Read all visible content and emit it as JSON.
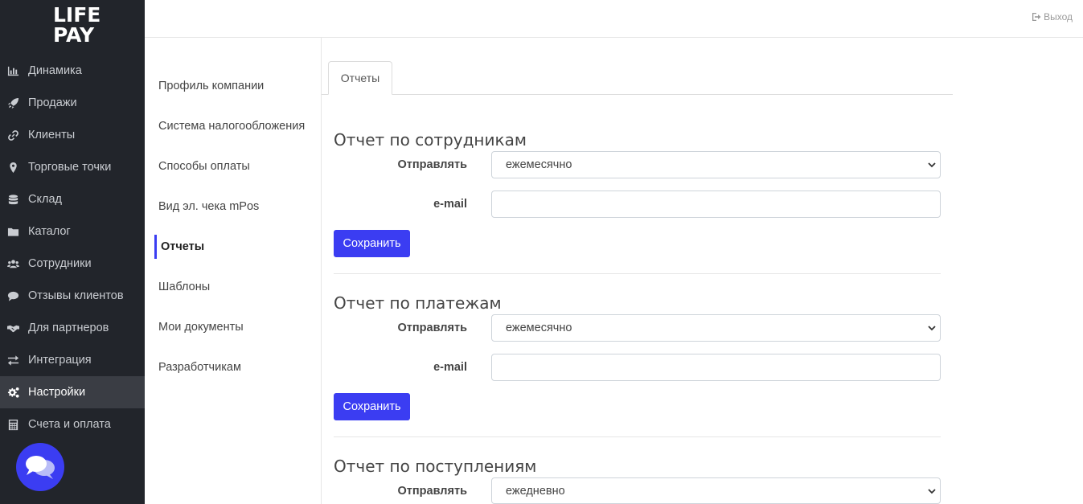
{
  "logo": {
    "line1": "LIFE",
    "line2": "PAY"
  },
  "sidebar": {
    "items": [
      {
        "label": "Динамика",
        "icon": "bar-chart-icon",
        "active": false
      },
      {
        "label": "Продажи",
        "icon": "rocket-icon",
        "active": false
      },
      {
        "label": "Клиенты",
        "icon": "link-icon",
        "active": false
      },
      {
        "label": "Торговые точки",
        "icon": "map-marker-icon",
        "active": false
      },
      {
        "label": "Склад",
        "icon": "database-icon",
        "active": false
      },
      {
        "label": "Каталог",
        "icon": "folder-icon",
        "active": false
      },
      {
        "label": "Сотрудники",
        "icon": "users-icon",
        "active": false
      },
      {
        "label": "Отзывы клиентов",
        "icon": "comment-icon",
        "active": false
      },
      {
        "label": "Для партнеров",
        "icon": "handshake-icon",
        "active": false
      },
      {
        "label": "Интеграция",
        "icon": "exchange-icon",
        "active": false
      },
      {
        "label": "Настройки",
        "icon": "gears-icon",
        "active": true
      },
      {
        "label": "Счета и оплата",
        "icon": "calculator-icon",
        "active": false
      }
    ]
  },
  "topbar": {
    "logout_label": "Выход"
  },
  "submenu": {
    "items": [
      {
        "label": "Профиль компании"
      },
      {
        "label": "Система налогообложения"
      },
      {
        "label": "Способы оплаты"
      },
      {
        "label": "Вид эл. чека mPos"
      },
      {
        "label": "Отчеты",
        "active": true
      },
      {
        "label": "Шаблоны"
      },
      {
        "label": "Мои документы"
      },
      {
        "label": "Разработчикам"
      }
    ]
  },
  "tabs": [
    {
      "label": "Отчеты",
      "active": true
    }
  ],
  "sections": [
    {
      "title": "Отчет по сотрудникам",
      "send_label": "Отправлять",
      "send_value": "ежемесячно",
      "email_label": "e-mail",
      "email_value": "",
      "save_label": "Сохранить"
    },
    {
      "title": "Отчет по платежам",
      "send_label": "Отправлять",
      "send_value": "ежемесячно",
      "email_label": "e-mail",
      "email_value": "",
      "save_label": "Сохранить"
    },
    {
      "title": "Отчет по поступлениям",
      "send_label": "Отправлять",
      "send_value": "ежедневно"
    }
  ],
  "colors": {
    "sidebar_bg": "#22252b",
    "accent": "#3b3df2",
    "active_item_bg": "#3a3d44"
  }
}
